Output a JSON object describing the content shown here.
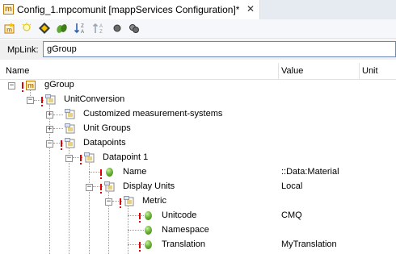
{
  "tab": {
    "title": "Config_1.mpcomunit [mappServices Configuration]*",
    "close": "✕"
  },
  "toolbar": {
    "buttons": [
      "add-icon",
      "light-icon",
      "navigate-icon",
      "leaves-icon",
      "sort-descending-icon",
      "sort-ascending-icon",
      "circle-icon",
      "circles-icon"
    ]
  },
  "mplink": {
    "label": "MpLink:",
    "value": "gGroup"
  },
  "columns": {
    "name": "Name",
    "value": "Value",
    "unit": "Unit"
  },
  "tree": [
    {
      "label": "gGroup",
      "value": ""
    },
    {
      "label": "UnitConversion",
      "value": ""
    },
    {
      "label": "Customized measurement-systems",
      "value": ""
    },
    {
      "label": "Unit Groups",
      "value": ""
    },
    {
      "label": "Datapoints",
      "value": ""
    },
    {
      "label": "Datapoint 1",
      "value": ""
    },
    {
      "label": "Name",
      "value": "::Data:Material"
    },
    {
      "label": "Display Units",
      "value": "Local"
    },
    {
      "label": "Metric",
      "value": ""
    },
    {
      "label": "Unitcode",
      "value": "CMQ"
    },
    {
      "label": "Namespace",
      "value": ""
    },
    {
      "label": "Translation",
      "value": "MyTranslation"
    }
  ]
}
